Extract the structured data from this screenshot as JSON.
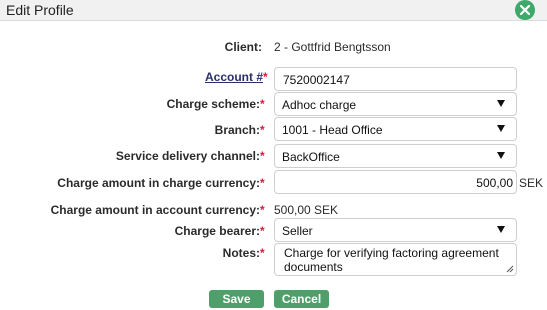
{
  "window": {
    "title": "Edit Profile",
    "close_icon": "close-x-icon",
    "accent": "#3fa86b"
  },
  "form": {
    "client": {
      "label": "Client:",
      "value": "2 - Gottfrid Bengtsson"
    },
    "account": {
      "label": "Account #",
      "required_mark": "*",
      "value": "7520002147"
    },
    "charge_scheme": {
      "label": "Charge scheme:",
      "required_mark": "*",
      "value": "Adhoc charge"
    },
    "branch": {
      "label": "Branch:",
      "required_mark": "*",
      "value": "1001 - Head Office"
    },
    "service_delivery_channel": {
      "label": "Service delivery channel:",
      "required_mark": "*",
      "value": "BackOffice"
    },
    "charge_amount_charge_currency": {
      "label": "Charge amount in charge currency:",
      "required_mark": "*",
      "value": "500,00",
      "suffix": "SEK"
    },
    "charge_amount_account_currency": {
      "label": "Charge amount in account currency:",
      "required_mark": "*",
      "value": "500,00 SEK"
    },
    "charge_bearer": {
      "label": "Charge bearer:",
      "required_mark": "*",
      "value": "Seller"
    },
    "notes": {
      "label": "Notes:",
      "required_mark": "*",
      "value": "Charge for verifying factoring agreement documents"
    }
  },
  "buttons": {
    "save": "Save",
    "cancel": "Cancel",
    "color": "#4f9f6b"
  },
  "colors": {
    "required": "#d1203b"
  }
}
